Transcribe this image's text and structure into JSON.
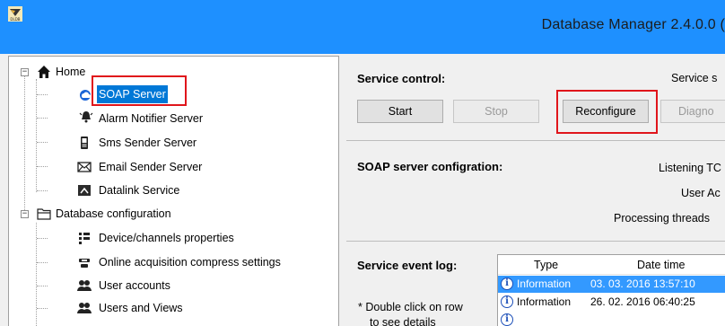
{
  "window": {
    "title": "Database Manager  2.4.0.0  (",
    "icon": "dldb-app-icon",
    "icon_text": "DLDB"
  },
  "tree": {
    "items": [
      {
        "label": "Home",
        "icon": "home-icon"
      },
      {
        "label": "SOAP Server",
        "icon": "cloud-server-icon"
      },
      {
        "label": "Alarm Notifier Server",
        "icon": "alarm-bell-icon"
      },
      {
        "label": "Sms Sender Server",
        "icon": "phone-icon"
      },
      {
        "label": "Email Sender Server",
        "icon": "envelope-icon"
      },
      {
        "label": "Datalink Service",
        "icon": "datalink-icon"
      },
      {
        "label": "Database configuration",
        "icon": "folder-icon"
      },
      {
        "label": "Device/channels properties",
        "icon": "channels-icon"
      },
      {
        "label": "Online acquisition compress settings",
        "icon": "compress-icon"
      },
      {
        "label": "User accounts",
        "icon": "users-icon"
      },
      {
        "label": "Users and Views",
        "icon": "users-views-icon"
      }
    ]
  },
  "service_control": {
    "label": "Service control:",
    "status_label": "Service s",
    "buttons": {
      "start": "Start",
      "stop": "Stop",
      "reconfigure": "Reconfigure",
      "diagnose": "Diagno"
    }
  },
  "soap_config": {
    "label": "SOAP server configration:",
    "listening": "Listening TC",
    "user_ac": "User Ac",
    "processing_threads": "Processing threads"
  },
  "event_log": {
    "label": "Service event log:",
    "hint": "* Double click on row",
    "hint2": "to see details",
    "columns": {
      "type": "Type",
      "datetime": "Date time"
    },
    "rows": [
      {
        "type": "Information",
        "datetime": "03. 03. 2016  13:57:10"
      },
      {
        "type": "Information",
        "datetime": "26. 02. 2016  06:40:25"
      }
    ]
  },
  "colors": {
    "titlebar": "#1e90ff",
    "selection": "#0078d7",
    "highlight": "#e0151b"
  }
}
